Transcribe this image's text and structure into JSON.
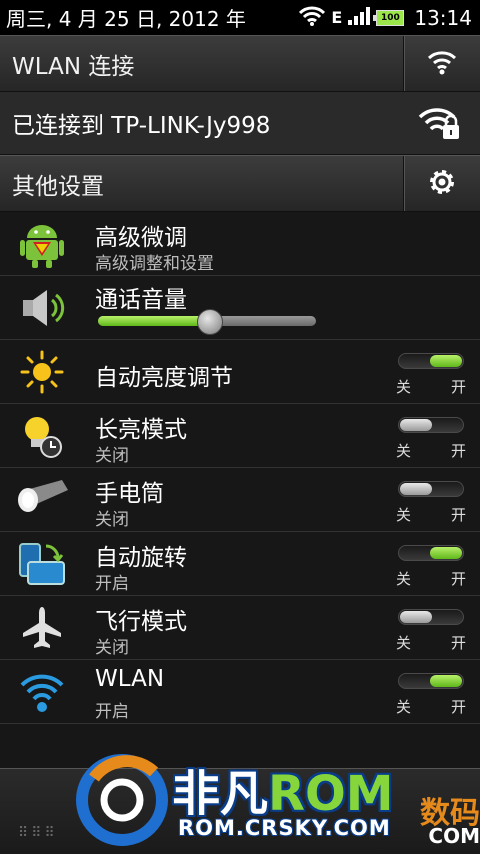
{
  "status_bar": {
    "date": "周三, 4 月 25 日, 2012 年",
    "network": "E",
    "battery": "100",
    "time": "13:14"
  },
  "wlan_header": {
    "title": "WLAN 连接",
    "icon": "wifi-icon"
  },
  "wlan_connection": {
    "text": "已连接到 TP-LINK-Jy998",
    "icon": "wifi-lock-icon"
  },
  "other_header": {
    "title": "其他设置",
    "icon": "gear-icon"
  },
  "items": [
    {
      "name": "advanced-tweaks",
      "title": "高级微调",
      "subtitle": "高级调整和设置",
      "icon": "android-superman-icon"
    },
    {
      "name": "call-volume",
      "title": "通话音量",
      "icon": "speaker-icon",
      "slider_level": 0.51
    },
    {
      "name": "auto-brightness",
      "title": "自动亮度调节",
      "icon": "sun-icon",
      "toggle": "on"
    },
    {
      "name": "screen-on-mode",
      "title": "长亮模式",
      "subtitle": "关闭",
      "icon": "bulb-clock-icon",
      "toggle": "off"
    },
    {
      "name": "flashlight",
      "title": "手电筒",
      "subtitle": "关闭",
      "icon": "flashlight-icon",
      "toggle": "off"
    },
    {
      "name": "auto-rotate",
      "title": "自动旋转",
      "subtitle": "开启",
      "icon": "rotate-icon",
      "toggle": "on"
    },
    {
      "name": "airplane-mode",
      "title": "飞行模式",
      "subtitle": "关闭",
      "icon": "airplane-icon",
      "toggle": "off"
    },
    {
      "name": "wlan",
      "title": "WLAN",
      "subtitle": "开启",
      "icon": "wifi-icon",
      "toggle": "on"
    }
  ],
  "toggle_labels": {
    "off": "关",
    "on": "开"
  },
  "watermark": {
    "brand_cn": "非凡",
    "brand_rom": "ROM",
    "url": "ROM.CRSKY.COM",
    "side": "数码",
    "side2": "COM"
  },
  "colors": {
    "accent_green": "#7fd030",
    "background": "#171717"
  }
}
